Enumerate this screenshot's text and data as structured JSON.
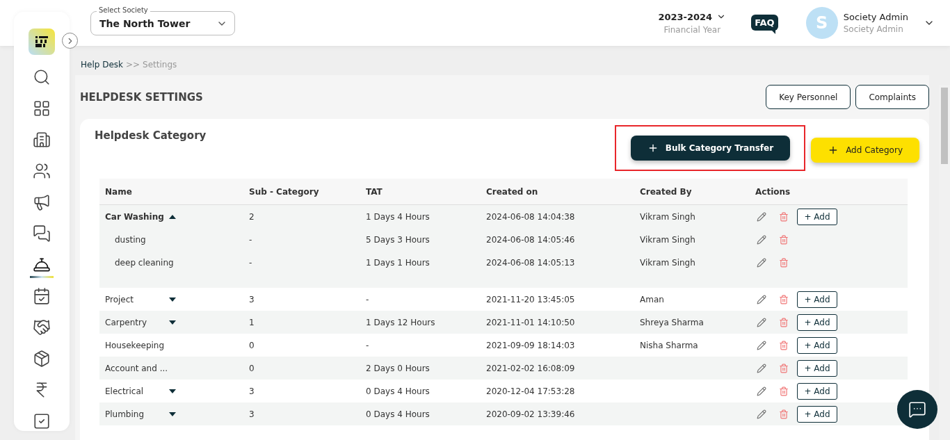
{
  "header": {
    "society_select": {
      "label": "Select Society",
      "value": "The North Tower"
    },
    "financial_year": {
      "value": "2023-2024",
      "label": "Financial Year"
    },
    "faq": "FAQ",
    "user": {
      "initial": "S",
      "name": "Society Admin",
      "role": "Society Admin"
    }
  },
  "sidebar": {
    "items": [
      {
        "selected": false
      },
      {
        "selected": false
      },
      {
        "selected": false
      },
      {
        "selected": false
      },
      {
        "selected": false
      },
      {
        "selected": false
      },
      {
        "selected": true
      },
      {
        "selected": false
      },
      {
        "selected": false
      },
      {
        "selected": false
      },
      {
        "selected": false
      },
      {
        "selected": false
      }
    ]
  },
  "breadcrumb": {
    "parent": "Help Desk",
    "separator": ">>",
    "current": "Settings"
  },
  "page_title": "HELPDESK SETTINGS",
  "top_buttons": [
    "Key Personnel",
    "Complaints"
  ],
  "card": {
    "title": "Helpdesk Category",
    "buttons": [
      {
        "kind": "dark",
        "label": "Bulk Category Transfer",
        "highlighted": true
      },
      {
        "kind": "yellow",
        "label": "Add Category",
        "highlighted": false
      }
    ]
  },
  "table": {
    "columns": [
      "Name",
      "Sub - Category",
      "TAT",
      "Created on",
      "Created By",
      "Actions"
    ],
    "rows": [
      {
        "name": "Car Washing",
        "sub_category": "2",
        "tat": "1 Days 4 Hours",
        "created_on": "2024-06-08 14:04:38",
        "created_by": "Vikram Singh",
        "expanded": true,
        "add_label": "+ Add",
        "children": [
          {
            "name": "dusting",
            "sub_category": "-",
            "tat": "5 Days 3 Hours",
            "created_on": "2024-06-08 14:05:46",
            "created_by": "Vikram Singh"
          },
          {
            "name": "deep cleaning",
            "sub_category": "-",
            "tat": "1 Days 1 Hours",
            "created_on": "2024-06-08 14:05:13",
            "created_by": "Vikram Singh"
          }
        ]
      },
      {
        "name": "Project",
        "sub_category": "3",
        "tat": "-",
        "created_on": "2021-11-20 13:45:05",
        "created_by": "Aman",
        "expanded": false,
        "add_label": "+ Add"
      },
      {
        "name": "Carpentry",
        "sub_category": "1",
        "tat": "1 Days 12 Hours",
        "created_on": "2021-11-01 14:10:50",
        "created_by": "Shreya Sharma",
        "expanded": false,
        "add_label": "+ Add"
      },
      {
        "name": "Housekeeping",
        "sub_category": "0",
        "tat": "-",
        "created_on": "2021-09-09 18:14:03",
        "created_by": "Nisha Sharma",
        "add_label": "+ Add"
      },
      {
        "name": "Account and ...",
        "sub_category": "0",
        "tat": "2 Days 0 Hours",
        "created_on": "2021-02-02 16:08:09",
        "created_by": "",
        "add_label": "+ Add"
      },
      {
        "name": "Electrical",
        "sub_category": "3",
        "tat": "0 Days 4 Hours",
        "created_on": "2020-12-04 17:53:28",
        "created_by": "",
        "expanded": false,
        "add_label": "+ Add"
      },
      {
        "name": "Plumbing",
        "sub_category": "3",
        "tat": "0 Days 4 Hours",
        "created_on": "2020-09-02 13:39:46",
        "created_by": "",
        "expanded": false,
        "add_label": "+ Add"
      }
    ]
  }
}
